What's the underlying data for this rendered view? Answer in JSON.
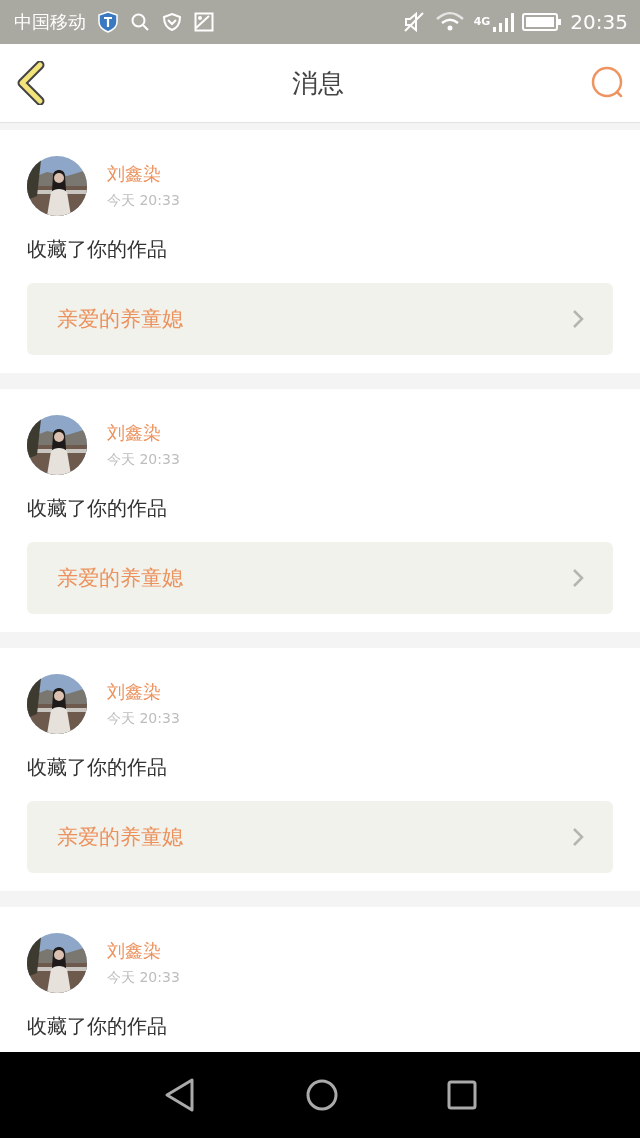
{
  "status_bar": {
    "carrier": "中国移动",
    "network": "4G",
    "time": "20:35"
  },
  "header": {
    "title": "消息"
  },
  "messages": [
    {
      "name": "刘鑫染",
      "time": "今天 20:33",
      "action": "收藏了你的作品",
      "work": "亲爱的养童媳"
    },
    {
      "name": "刘鑫染",
      "time": "今天 20:33",
      "action": "收藏了你的作品",
      "work": "亲爱的养童媳"
    },
    {
      "name": "刘鑫染",
      "time": "今天 20:33",
      "action": "收藏了你的作品",
      "work": "亲爱的养童媳"
    },
    {
      "name": "刘鑫染",
      "time": "今天 20:33",
      "action": "收藏了你的作品"
    }
  ]
}
